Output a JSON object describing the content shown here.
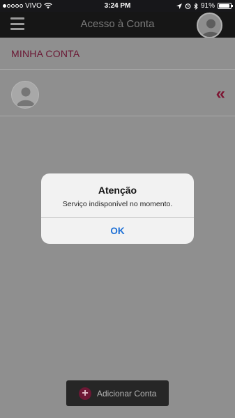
{
  "status_bar": {
    "carrier": "VIVO",
    "time": "3:24 PM",
    "battery": "91%",
    "battery_level": 0.91,
    "icons": [
      "signal-dots-icon",
      "wifi-icon",
      "location-arrow-icon",
      "alarm-icon",
      "bluetooth-icon",
      "battery-icon"
    ]
  },
  "nav": {
    "title": "Acesso à Conta",
    "icons": [
      "menu-icon",
      "profile-icon"
    ]
  },
  "section": {
    "title": "MINHA CONTA",
    "collapse_glyph": "«"
  },
  "dialog": {
    "title": "Atenção",
    "message": "Serviço indisponível no momento.",
    "ok_label": "OK"
  },
  "add_button": {
    "label": "Adicionar Conta",
    "icon_glyph": "+"
  },
  "colors": {
    "accent": "#6d1835",
    "link_blue": "#1c6fd6",
    "nav_bg": "#161616",
    "overlay_bg": "#8f8f8f"
  }
}
